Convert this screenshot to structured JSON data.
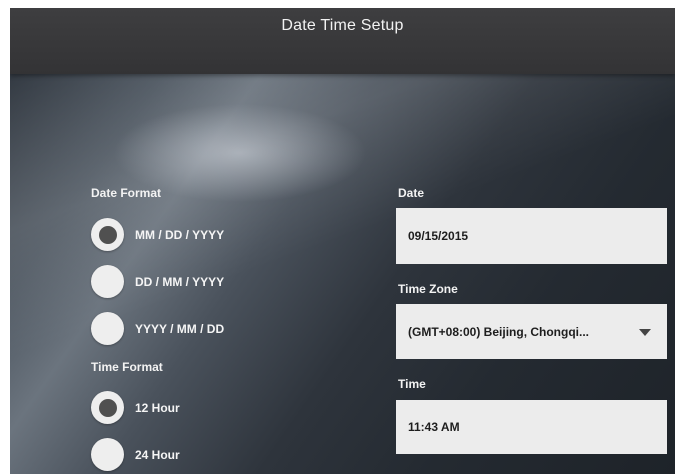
{
  "header": {
    "title": "Date Time Setup"
  },
  "date_format": {
    "label": "Date Format",
    "options": [
      {
        "label": "MM / DD / YYYY",
        "selected": true
      },
      {
        "label": "DD / MM / YYYY",
        "selected": false
      },
      {
        "label": "YYYY / MM / DD",
        "selected": false
      }
    ]
  },
  "time_format": {
    "label": "Time Format",
    "options": [
      {
        "label": "12 Hour",
        "selected": true
      },
      {
        "label": "24 Hour",
        "selected": false
      }
    ]
  },
  "date": {
    "label": "Date",
    "value": "09/15/2015"
  },
  "time_zone": {
    "label": "Time Zone",
    "value": "(GMT+08:00) Beijing, Chongqi..."
  },
  "time": {
    "label": "Time",
    "value": "11:43 AM"
  },
  "colors": {
    "field_background": "#ececec",
    "radio_fill": "#eeeeee",
    "radio_selected_dot": "#505050",
    "title_bar": "#3a3a3c"
  }
}
